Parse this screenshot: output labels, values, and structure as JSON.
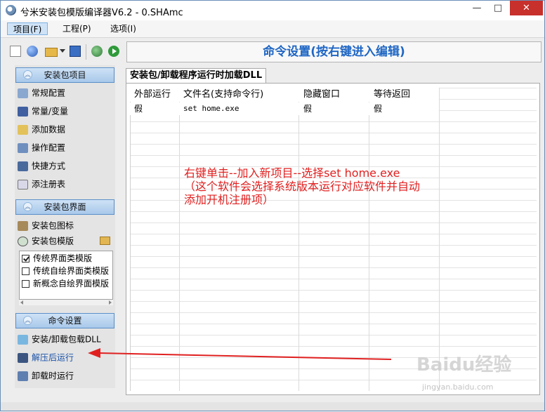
{
  "window": {
    "title": "兮米安装包模版编译器V6.2 - 0.SHAmc",
    "controls": {
      "minimize": "—",
      "maximize": "□",
      "close": "✕"
    }
  },
  "menubar": {
    "items": [
      {
        "label": "项目(F)",
        "active": true
      },
      {
        "label": "工程(P)",
        "active": false
      },
      {
        "label": "选项(I)",
        "active": false
      }
    ]
  },
  "toolbar": {
    "icons": [
      "new-file-icon",
      "circle-icon",
      "open-folder-icon",
      "dropdown-icon",
      "save-icon",
      "globe-icon",
      "run-icon"
    ]
  },
  "sidebar": {
    "group1": {
      "header": "安装包项目",
      "items": [
        {
          "label": "常规配置",
          "icon": "config-icon"
        },
        {
          "label": "常量/变量",
          "icon": "variable-icon"
        },
        {
          "label": "添加数据",
          "icon": "data-icon"
        },
        {
          "label": "操作配置",
          "icon": "operation-icon"
        },
        {
          "label": "快捷方式",
          "icon": "shortcut-icon"
        },
        {
          "label": "添注册表",
          "icon": "registry-icon"
        }
      ]
    },
    "group2": {
      "header": "安装包界面",
      "items": [
        {
          "label": "安装包图标",
          "icon": "package-icon"
        },
        {
          "label": "安装包模版",
          "icon": "template-icon"
        }
      ],
      "templates": [
        {
          "label": "传统界面类模版",
          "checked": true
        },
        {
          "label": "传统自绘界面类模版",
          "checked": false
        },
        {
          "label": "新概念自绘界面模版",
          "checked": false
        }
      ]
    },
    "group3": {
      "header": "命令设置",
      "items": [
        {
          "label": "安装/卸载包载DLL",
          "icon": "dll-icon"
        },
        {
          "label": "解压后运行",
          "icon": "run-after-extract-icon",
          "selected": true
        },
        {
          "label": "卸载时运行",
          "icon": "run-on-uninstall-icon"
        }
      ]
    }
  },
  "main": {
    "panel_title": "命令设置(按右键进入编辑)",
    "tab_label": "安装包/卸载程序运行时加载DLL",
    "table": {
      "columns": [
        "外部运行",
        "文件名(支持命令行)",
        "隐藏窗口",
        "等待返回"
      ],
      "rows": [
        [
          "假",
          "set home.exe",
          "假",
          "假"
        ]
      ]
    }
  },
  "annotation": {
    "line1": "右键单击--加入新项目--选择set home.exe",
    "line2": "（这个软件会选择系统版本运行对应软件并自动",
    "line3": "添加开机注册项）",
    "color": "#e02020"
  },
  "watermark": {
    "text": "Baidu经验",
    "sub": "jingyan.baidu.com"
  }
}
